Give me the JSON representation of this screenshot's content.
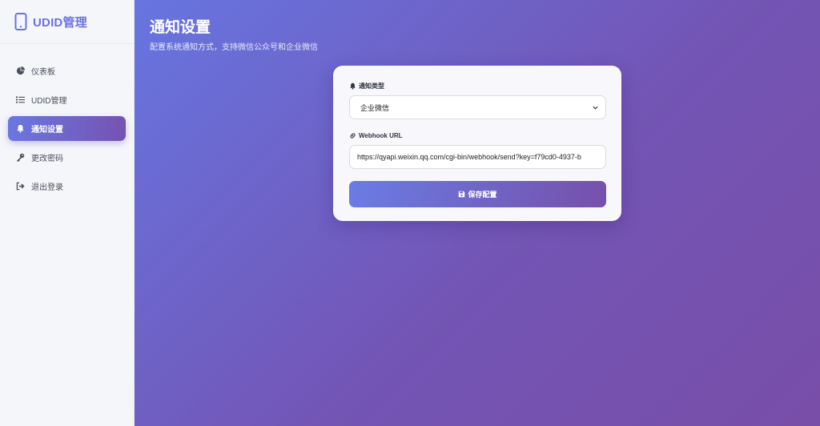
{
  "brand": {
    "title": "UDID管理",
    "icon": "phone-icon",
    "color": "#6a72de"
  },
  "sidebar": {
    "items": [
      {
        "label": "仪表板",
        "icon": "pie-chart-icon",
        "active": false
      },
      {
        "label": "UDID管理",
        "icon": "list-icon",
        "active": false
      },
      {
        "label": "通知设置",
        "icon": "bell-icon",
        "active": true
      },
      {
        "label": "更改密码",
        "icon": "key-icon",
        "active": false
      },
      {
        "label": "退出登录",
        "icon": "sign-out-icon",
        "active": false
      }
    ]
  },
  "page": {
    "title": "通知设置",
    "subtitle": "配置系统通知方式，支持微信公众号和企业微信"
  },
  "form": {
    "type_label": "通知类型",
    "type_value": "企业微信",
    "webhook_label": "Webhook URL",
    "webhook_value": "https://qyapi.weixin.qq.com/cgi-bin/webhook/send?key=f79cd0-4937-b",
    "save_label": "保存配置"
  },
  "colors": {
    "accent_start": "#6a78e2",
    "accent_end": "#7652b0"
  }
}
